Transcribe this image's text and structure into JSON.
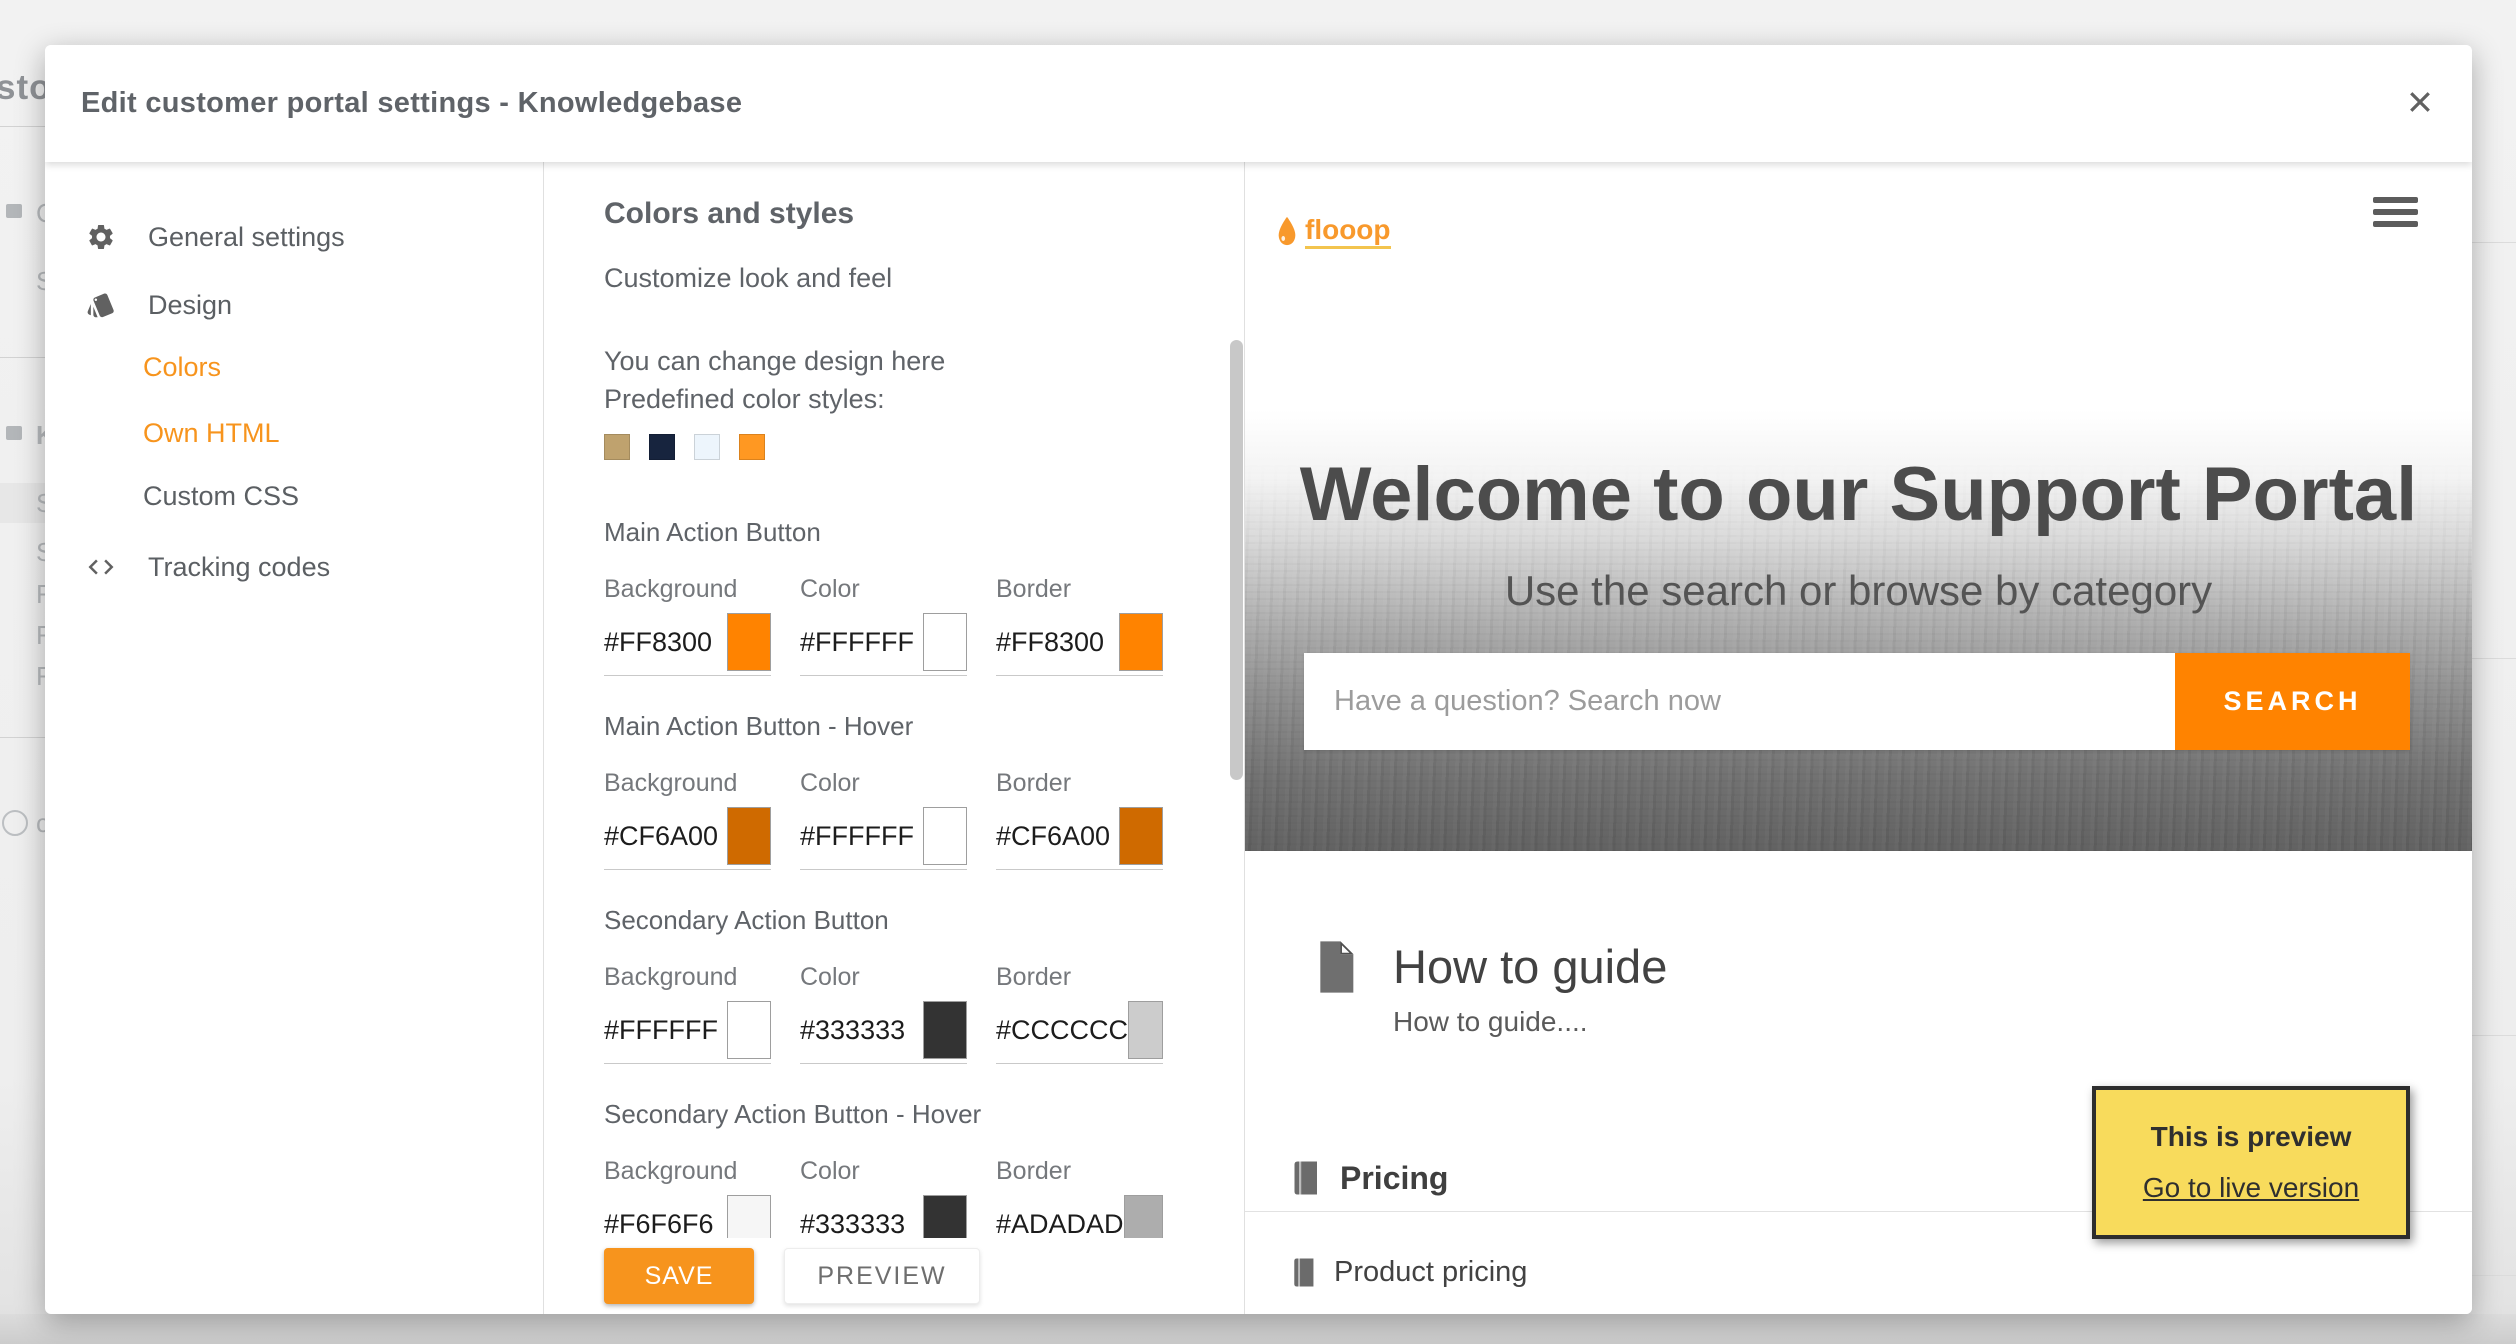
{
  "modal": {
    "title": "Edit customer portal settings - Knowledgebase"
  },
  "sidebar": {
    "items": [
      {
        "label": "General settings",
        "icon": "gear"
      },
      {
        "label": "Design",
        "icon": "style"
      },
      {
        "label": "Colors",
        "active": true
      },
      {
        "label": "Own HTML",
        "active": true
      },
      {
        "label": "Custom CSS",
        "active": false
      },
      {
        "label": "Tracking codes",
        "icon": "code"
      }
    ]
  },
  "settings_panel": {
    "heading": "Colors and styles",
    "subheading": "Customize look and feel",
    "hint_line1": "You can change design here",
    "hint_line2": "Predefined color styles:",
    "predefined_colors": [
      "#BFA26E",
      "#17243E",
      "#EDF5FC",
      "#FF9822"
    ],
    "sections": [
      {
        "title": "Main Action Button",
        "fields": [
          {
            "label": "Background",
            "value": "#FF8300"
          },
          {
            "label": "Color",
            "value": "#FFFFFF"
          },
          {
            "label": "Border",
            "value": "#FF8300"
          }
        ]
      },
      {
        "title": "Main Action Button - Hover",
        "fields": [
          {
            "label": "Background",
            "value": "#CF6A00"
          },
          {
            "label": "Color",
            "value": "#FFFFFF"
          },
          {
            "label": "Border",
            "value": "#CF6A00"
          }
        ]
      },
      {
        "title": "Secondary Action Button",
        "fields": [
          {
            "label": "Background",
            "value": "#FFFFFF"
          },
          {
            "label": "Color",
            "value": "#333333"
          },
          {
            "label": "Border",
            "value": "#CCCCCC"
          }
        ]
      },
      {
        "title": "Secondary Action Button - Hover",
        "fields": [
          {
            "label": "Background",
            "value": "#F6F6F6"
          },
          {
            "label": "Color",
            "value": "#333333"
          },
          {
            "label": "Border",
            "value": "#ADADAD"
          }
        ]
      }
    ],
    "save_label": "SAVE",
    "preview_label": "PREVIEW"
  },
  "preview": {
    "logo_text": "flooop",
    "hero_title": "Welcome to our Support Portal",
    "hero_subtitle": "Use the search or browse by category",
    "search_placeholder": "Have a question? Search now",
    "search_button": "SEARCH",
    "category1": {
      "title": "How to guide",
      "description": "How to guide...."
    },
    "category2": {
      "title": "Pricing"
    },
    "article1": {
      "title": "Product pricing"
    },
    "banner": {
      "line1": "This is preview",
      "line2": "Go to live version"
    }
  },
  "background": {
    "partial_text": "stor",
    "partial_items": [
      "C",
      "S",
      "K",
      "S",
      "S",
      "F",
      "F",
      "F",
      "c"
    ]
  },
  "colors": {
    "accent_orange": "#F7941D",
    "search_button_bg": "#FF8300",
    "banner_yellow": "#F8DB5C"
  }
}
